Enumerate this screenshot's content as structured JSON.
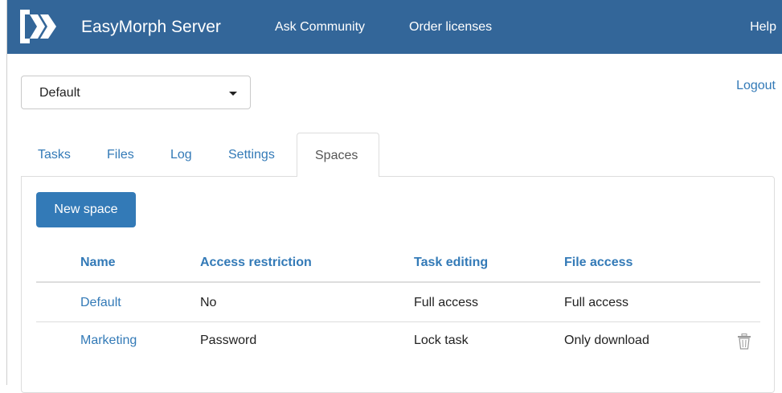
{
  "navbar": {
    "brand": "EasyMorph Server",
    "links": {
      "ask_community": "Ask Community",
      "order_licenses": "Order licenses",
      "help": "Help"
    }
  },
  "space_select": {
    "selected": "Default"
  },
  "logout": "Logout",
  "tabs": [
    {
      "label": "Tasks"
    },
    {
      "label": "Files"
    },
    {
      "label": "Log"
    },
    {
      "label": "Settings"
    },
    {
      "label": "Spaces",
      "active": true
    }
  ],
  "new_space_button": "New space",
  "table": {
    "headers": [
      "Name",
      "Access restriction",
      "Task editing",
      "File access"
    ],
    "rows": [
      {
        "name": "Default",
        "access_restriction": "No",
        "task_editing": "Full access",
        "file_access": "Full access",
        "delete_icon": false
      },
      {
        "name": "Marketing",
        "access_restriction": "Password",
        "task_editing": "Lock task",
        "file_access": "Only download",
        "delete_icon": true
      }
    ]
  },
  "colors": {
    "navbar_bg": "#336699",
    "link": "#337ab7",
    "primary_button": "#337ab7"
  },
  "icons": {
    "logo": "easymorph-logo-icon",
    "delete": "trash-icon",
    "dropdown": "caret-down-icon"
  }
}
